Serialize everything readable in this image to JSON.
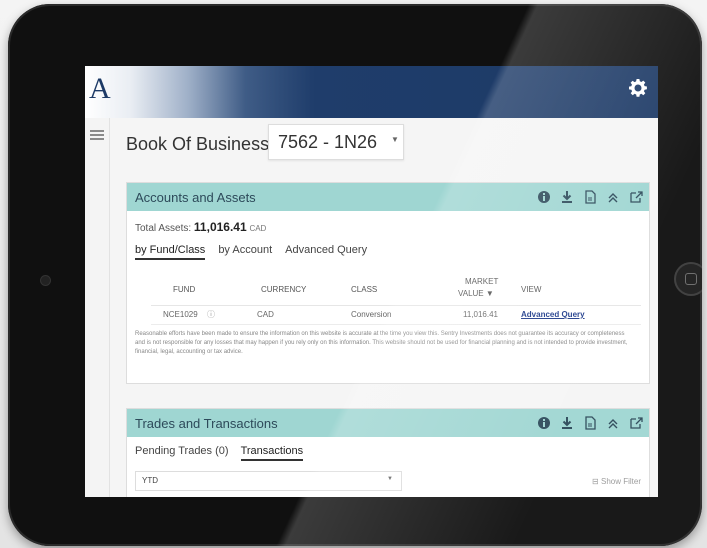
{
  "app": {
    "logo": "A"
  },
  "header": {
    "title": "Book Of Business",
    "selected_book": "7562 - 1N26"
  },
  "accounts": {
    "title": "Accounts and Assets",
    "total_label": "Total Assets:",
    "total_value": "11,016.41",
    "total_currency": "CAD",
    "tabs": [
      "by Fund/Class",
      "by Account",
      "Advanced Query"
    ],
    "columns": [
      "FUND",
      "CURRENCY",
      "CLASS",
      "MARKET",
      "VALUE ▼",
      "VIEW"
    ],
    "rows": [
      {
        "fund": "NCE1029",
        "currency": "CAD",
        "class": "Conversion",
        "market_value": "11,016.41",
        "view": "Advanced Query"
      }
    ],
    "disclaimer": "Reasonable efforts have been made to ensure the information on this website is accurate at the time you view this. Sentry Investments does not guarantee its accuracy or completeness and is not responsible for any losses that may happen if you rely only on this information. This website should not be used for financial planning and is not intended to provide investment, financial, legal, accounting or tax advice."
  },
  "trades": {
    "title": "Trades and Transactions",
    "tabs": [
      "Pending Trades (0)",
      "Transactions"
    ],
    "period": "YTD",
    "show_filter": "Show Filter"
  },
  "colors": {
    "panel_header": "#9fd6d2",
    "brand_navy": "#1d3a66",
    "link": "#1d3a8a"
  },
  "icons": [
    "gear-icon",
    "menu-icon",
    "info-icon",
    "download-icon",
    "pdf-icon",
    "collapse-icon",
    "external-link-icon"
  ]
}
